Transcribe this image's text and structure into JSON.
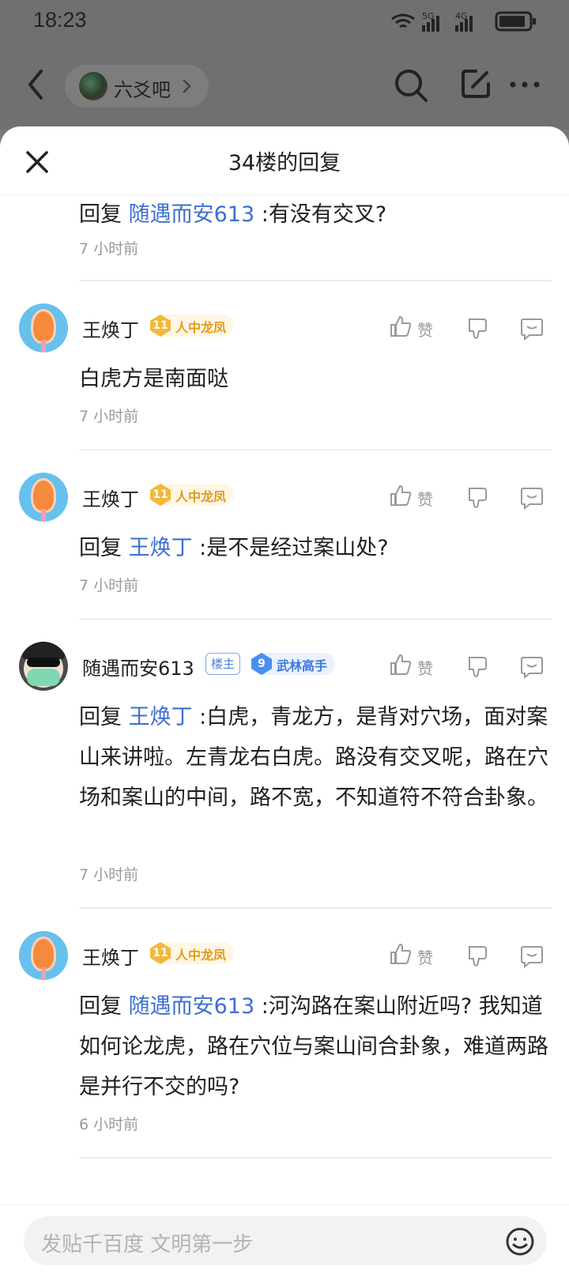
{
  "status_bar": {
    "time": "18:23",
    "network": [
      "5G",
      "4G"
    ]
  },
  "top_bar": {
    "forum_name": "六爻吧"
  },
  "sheet": {
    "title": "34楼的回复"
  },
  "comments": [
    {
      "user": "",
      "reply_prefix": "回复",
      "mention": "随遇而安613",
      "text": " :有没有交叉?",
      "time": "7 小时前"
    },
    {
      "user": "王焕丁",
      "level": "11",
      "title": "人中龙凤",
      "like_label": "赞",
      "text": "白虎方是南面哒",
      "time": "7 小时前"
    },
    {
      "user": "王焕丁",
      "level": "11",
      "title": "人中龙凤",
      "like_label": "赞",
      "reply_prefix": "回复",
      "mention": "王焕丁",
      "text": " :是不是经过案山处?",
      "time": "7 小时前"
    },
    {
      "user": "随遇而安613",
      "owner_badge": "楼主",
      "level": "9",
      "title": "武林高手",
      "like_label": "赞",
      "reply_prefix": "回复",
      "mention": "王焕丁",
      "text": " :白虎，青龙方，是背对穴场，面对案山来讲啦。左青龙右白虎。路没有交叉呢，路在穴场和案山的中间，路不宽，不知道符不符合卦象。",
      "time": "7 小时前"
    },
    {
      "user": "王焕丁",
      "level": "11",
      "title": "人中龙凤",
      "like_label": "赞",
      "reply_prefix": "回复",
      "mention": "随遇而安613",
      "text": " :河沟路在案山附近吗? 我知道如何论龙虎，路在穴位与案山间合卦象，难道两路是并行不交的吗?",
      "time": "6 小时前"
    }
  ],
  "bottom_bar": {
    "placeholder": "发贴千百度 文明第一步"
  }
}
